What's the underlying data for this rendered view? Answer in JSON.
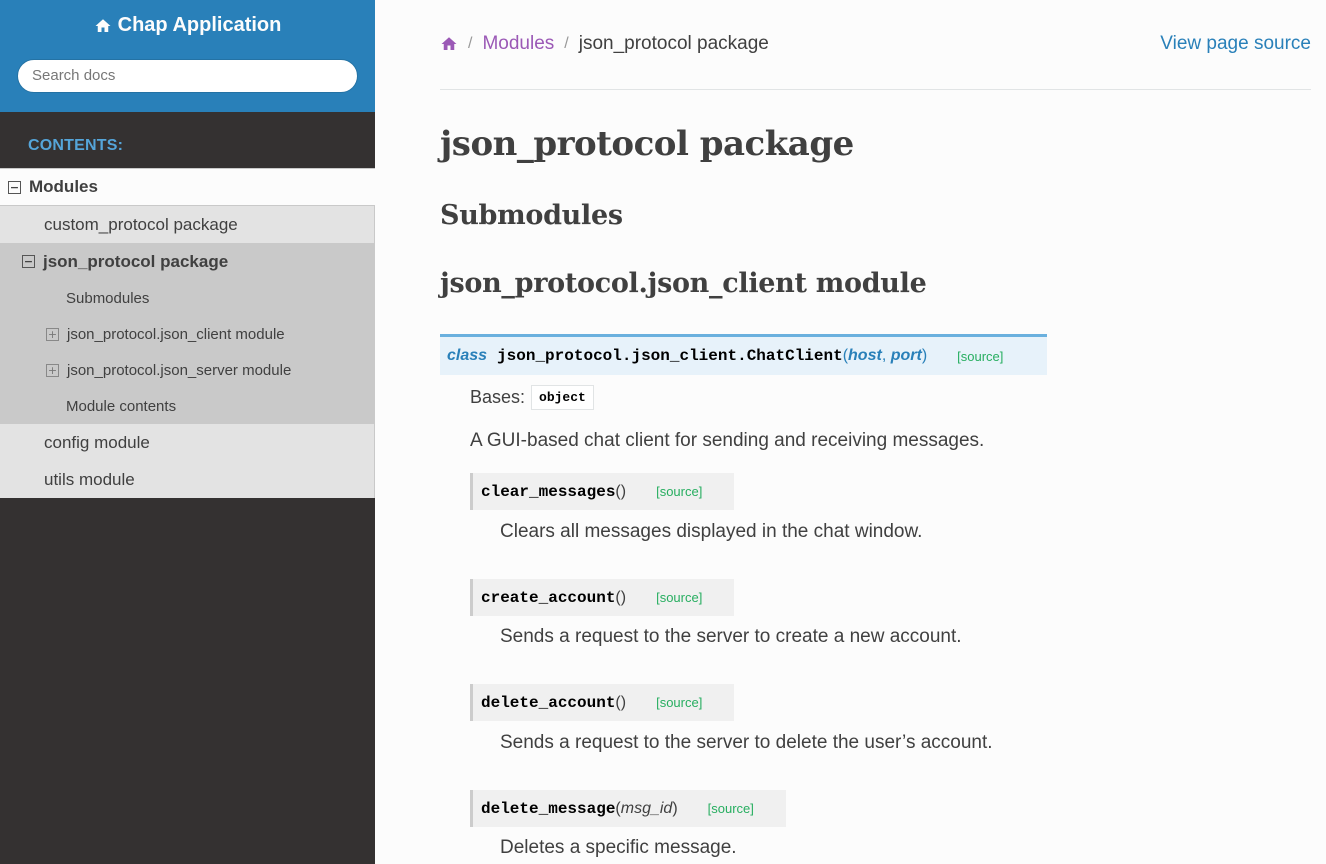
{
  "sidebar": {
    "brand": "Chap Application",
    "search_placeholder": "Search docs",
    "caption": "CONTENTS:",
    "top_item": "Modules",
    "items": [
      {
        "label": "custom_protocol package"
      },
      {
        "label": "json_protocol package"
      },
      {
        "label": "Submodules"
      },
      {
        "label": "json_protocol.json_client module"
      },
      {
        "label": "json_protocol.json_server module"
      },
      {
        "label": "Module contents"
      },
      {
        "label": "config module"
      },
      {
        "label": "utils module"
      }
    ]
  },
  "breadcrumb": {
    "parent": "Modules",
    "separator": "/",
    "current": "json_protocol package",
    "view_source": "View page source"
  },
  "content": {
    "title": "json_protocol package",
    "submodules_heading": "Submodules",
    "module_heading": "json_protocol.json_client module",
    "class_sig": {
      "keyword": "class",
      "name": "json_protocol.json_client.ChatClient",
      "open": "(",
      "param1": "host",
      "comma": ", ",
      "param2": "port",
      "close": ")",
      "source": "[source]"
    },
    "bases_label": "Bases:",
    "bases_value": "object",
    "class_desc": "A GUI-based chat client for sending and receiving messages.",
    "methods": [
      {
        "name": "clear_messages",
        "parens": "()",
        "source": "[source]",
        "desc": "Clears all messages displayed in the chat window."
      },
      {
        "name": "create_account",
        "parens": "()",
        "source": "[source]",
        "desc": "Sends a request to the server to create a new account."
      },
      {
        "name": "delete_account",
        "parens": "()",
        "source": "[source]",
        "desc": "Sends a request to the server to delete the user’s account."
      },
      {
        "name": "delete_message",
        "open": "(",
        "param": "msg_id",
        "close": ")",
        "source": "[source]",
        "desc": "Deletes a specific message."
      }
    ]
  },
  "colors": {
    "sidebar_header": "#2980b9",
    "sidebar_bg": "#343131",
    "link_visited": "#9b59b6",
    "link": "#2980b9",
    "source_link": "#27ae60"
  }
}
